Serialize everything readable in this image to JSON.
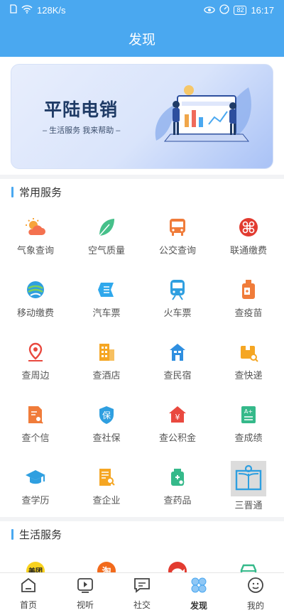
{
  "status": {
    "speed": "128K/s",
    "battery": "82",
    "time": "16:17"
  },
  "title": "发现",
  "banner": {
    "title": "平陆电销",
    "subtitle": "– 生活服务  我来帮助 –"
  },
  "common": {
    "heading": "常用服务",
    "items": [
      {
        "label": "气象查询",
        "icon": "weather-icon"
      },
      {
        "label": "空气质量",
        "icon": "leaf-icon"
      },
      {
        "label": "公交查询",
        "icon": "bus-icon"
      },
      {
        "label": "联通缴费",
        "icon": "unicom-icon"
      },
      {
        "label": "移动缴费",
        "icon": "china-mobile-icon"
      },
      {
        "label": "汽车票",
        "icon": "ticket-icon"
      },
      {
        "label": "火车票",
        "icon": "train-icon"
      },
      {
        "label": "查疫苗",
        "icon": "vaccine-icon"
      },
      {
        "label": "查周边",
        "icon": "location-icon"
      },
      {
        "label": "查酒店",
        "icon": "hotel-icon"
      },
      {
        "label": "查民宿",
        "icon": "homestay-icon"
      },
      {
        "label": "查快递",
        "icon": "parcel-icon"
      },
      {
        "label": "查个信",
        "icon": "credit-icon"
      },
      {
        "label": "查社保",
        "icon": "social-security-icon"
      },
      {
        "label": "查公积金",
        "icon": "housing-fund-icon"
      },
      {
        "label": "查成绩",
        "icon": "grades-icon"
      },
      {
        "label": "查学历",
        "icon": "graduation-cap-icon"
      },
      {
        "label": "查企业",
        "icon": "company-icon"
      },
      {
        "label": "查药品",
        "icon": "medicine-icon"
      },
      {
        "label": "三晋通",
        "icon": "book-reader-icon"
      }
    ]
  },
  "life": {
    "heading": "生活服务",
    "items": [
      {
        "label": "美团",
        "icon": "meituan-icon"
      },
      {
        "label": "淘",
        "icon": "taobao-icon"
      },
      {
        "label": "",
        "icon": "fish-icon"
      },
      {
        "label": "",
        "icon": "car-icon"
      }
    ]
  },
  "tabs": [
    {
      "label": "首页",
      "icon": "home-icon"
    },
    {
      "label": "视听",
      "icon": "video-icon"
    },
    {
      "label": "社交",
      "icon": "chat-icon"
    },
    {
      "label": "发现",
      "icon": "discover-icon"
    },
    {
      "label": "我的",
      "icon": "profile-icon"
    }
  ],
  "colors": {
    "primary": "#4aa8f0"
  }
}
